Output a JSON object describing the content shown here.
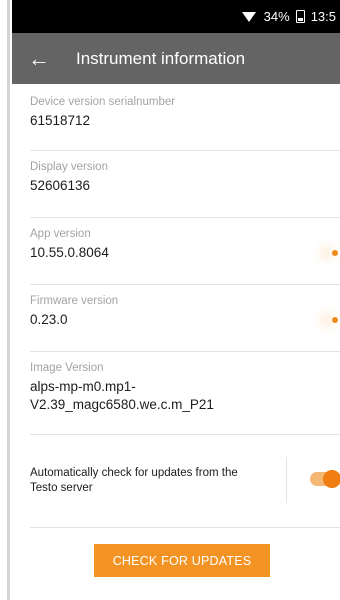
{
  "status_bar": {
    "battery_percent": "34%",
    "time": "13:5"
  },
  "app_bar": {
    "title": "Instrument information"
  },
  "fields": [
    {
      "label": "Device version serialnumber",
      "value": "61518712"
    },
    {
      "label": "Display version",
      "value": "52606136"
    },
    {
      "label": "App version",
      "value": "10.55.0.8064"
    },
    {
      "label": "Firmware version",
      "value": "0.23.0"
    },
    {
      "label": "Image Version",
      "value_line1": "alps-mp-m0.mp1-",
      "value_line2": "V2.39_magc6580.we.c.m_P21"
    }
  ],
  "auto_update": {
    "label_line1": "Automatically check for updates from the",
    "label_line2": "Testo server",
    "enabled": true
  },
  "check_button": {
    "label": "CHECK FOR UPDATES"
  },
  "colors": {
    "accent": "#f39324",
    "appbar": "#646464",
    "statusbar": "#000000"
  }
}
